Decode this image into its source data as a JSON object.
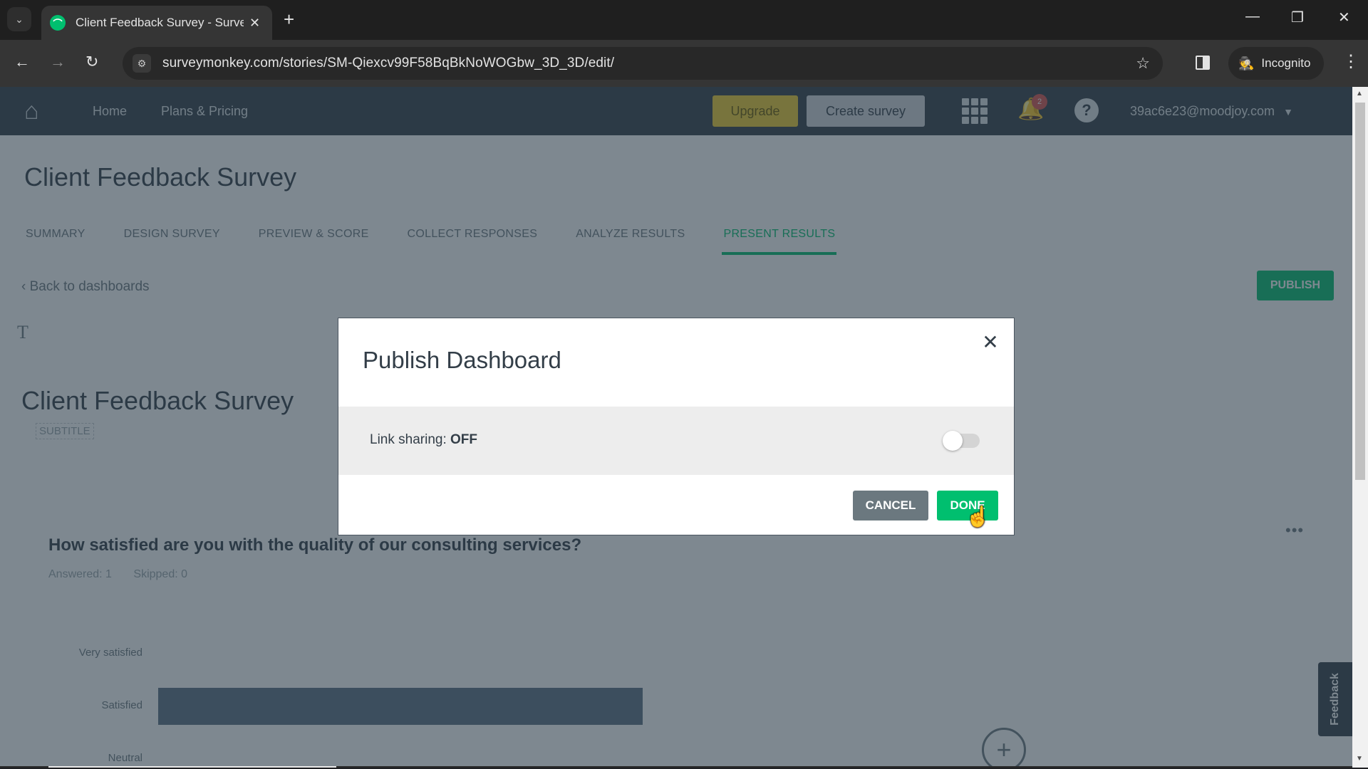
{
  "browser": {
    "tab_title": "Client Feedback Survey - SurveyMonkey",
    "url_host": "surveymonkey.com",
    "url_path": "/stories/SM-Qiexcv99F58BqBkNoWOGbw_3D_3D/edit/",
    "incognito_label": "Incognito",
    "icons": {
      "tab_search": "⌄",
      "favicon": "⌒",
      "tab_close": "✕",
      "new_tab": "+",
      "minimize": "—",
      "restore": "❐",
      "close": "✕",
      "back": "←",
      "forward": "→",
      "reload": "↻",
      "site_info": "⚙",
      "star": "☆",
      "incognito": "🕵",
      "menu": "⋮"
    }
  },
  "header": {
    "nav": [
      "Home",
      "Plans & Pricing"
    ],
    "upgrade_label": "Upgrade",
    "create_label": "Create survey",
    "notification_count": "2",
    "help_glyph": "?",
    "account": "39ac6e23@moodjoy.com",
    "account_caret": "▼",
    "bell_glyph": "🔔",
    "logo_glyph": "⌂"
  },
  "page": {
    "survey_title": "Client Feedback Survey",
    "tabs": [
      {
        "label": "SUMMARY",
        "active": false
      },
      {
        "label": "DESIGN SURVEY",
        "active": false
      },
      {
        "label": "PREVIEW & SCORE",
        "active": false
      },
      {
        "label": "COLLECT RESPONSES",
        "active": false
      },
      {
        "label": "ANALYZE RESULTS",
        "active": false
      },
      {
        "label": "PRESENT RESULTS",
        "active": true
      }
    ],
    "back_link": "‹ Back to dashboards",
    "publish_label": "PUBLISH",
    "text_tool_glyph": "T",
    "dashboard_title": "Client Feedback Survey",
    "subtitle_placeholder": "SUBTITLE",
    "question": "How satisfied are you with the quality of our consulting services?",
    "answered": "Answered: 1",
    "skipped": "Skipped: 0",
    "more_glyph": "•••",
    "chart_rows": [
      {
        "label": "Very satisfied",
        "fraction": 0
      },
      {
        "label": "Satisfied",
        "fraction": 1
      },
      {
        "label": "Neutral",
        "fraction": 0
      }
    ],
    "add_glyph": "+",
    "feedback_label": "Feedback"
  },
  "modal": {
    "title": "Publish Dashboard",
    "close_glyph": "✕",
    "link_sharing_label": "Link sharing:",
    "link_sharing_state": "OFF",
    "toggle_on": false,
    "cancel_label": "CANCEL",
    "done_label": "DONE",
    "cursor_glyph": "☝"
  },
  "colors": {
    "brand_green": "#00bf6f",
    "header_dark": "#333e48",
    "cancel_gray": "#6b787f"
  }
}
